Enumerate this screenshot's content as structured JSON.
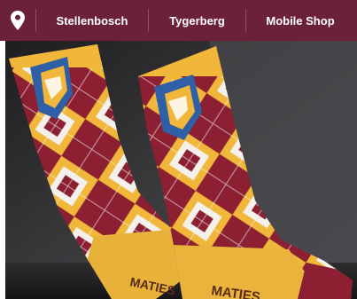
{
  "nav": {
    "location_icon": "map-pin-icon",
    "items": [
      {
        "label": "Stellenbosch"
      },
      {
        "label": "Tygerberg"
      },
      {
        "label": "Mobile Shop"
      }
    ]
  },
  "photo": {
    "sock_toe_text_left": "MATIES",
    "sock_toe_text_right": "MATIES"
  },
  "colors": {
    "bar": "#6b2238",
    "maroon": "#8c1f32",
    "gold": "#f0b73a",
    "white": "#f4f1ec"
  }
}
